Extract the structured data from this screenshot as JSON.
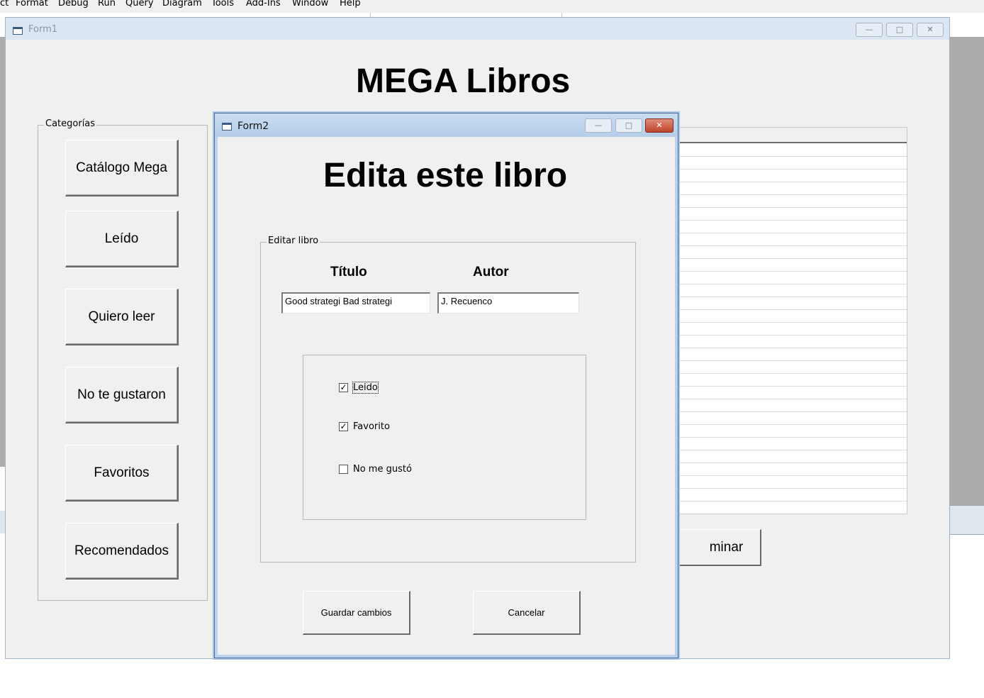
{
  "ide": {
    "menu": [
      {
        "label": "ct"
      },
      {
        "label": "Format"
      },
      {
        "label": "Debug"
      },
      {
        "label": "Run"
      },
      {
        "label": "Query"
      },
      {
        "label": "Diagram"
      },
      {
        "label": "Tools"
      },
      {
        "label": "Add-Ins"
      },
      {
        "label": "Window"
      },
      {
        "label": "Help"
      }
    ]
  },
  "form1": {
    "title": "Form1",
    "heading": "MEGA Libros",
    "categories_label": "Categorías",
    "categories": [
      {
        "label": "Catálogo Mega"
      },
      {
        "label": "Leído"
      },
      {
        "label": "Quiero leer"
      },
      {
        "label": "No te gustaron"
      },
      {
        "label": "Favoritos"
      },
      {
        "label": "Recomendados"
      }
    ],
    "partial_button_label": "minar",
    "caption_buttons": {
      "minimize": "—",
      "maximize": "□",
      "close": "✕"
    }
  },
  "form2": {
    "title": "Form2",
    "heading": "Edita este libro",
    "group_label": "Editar libro",
    "titulo_label": "Título",
    "autor_label": "Autor",
    "titulo_value": "Good strategi Bad strategi",
    "autor_value": "J. Recuenco",
    "checkboxes": [
      {
        "label": "Leido",
        "checked": true
      },
      {
        "label": "Favorito",
        "checked": true
      },
      {
        "label": "No me gustó",
        "checked": false
      }
    ],
    "save_label": "Guardar cambios",
    "cancel_label": "Cancelar",
    "caption_buttons": {
      "minimize": "—",
      "maximize": "□",
      "close": "✕"
    }
  }
}
